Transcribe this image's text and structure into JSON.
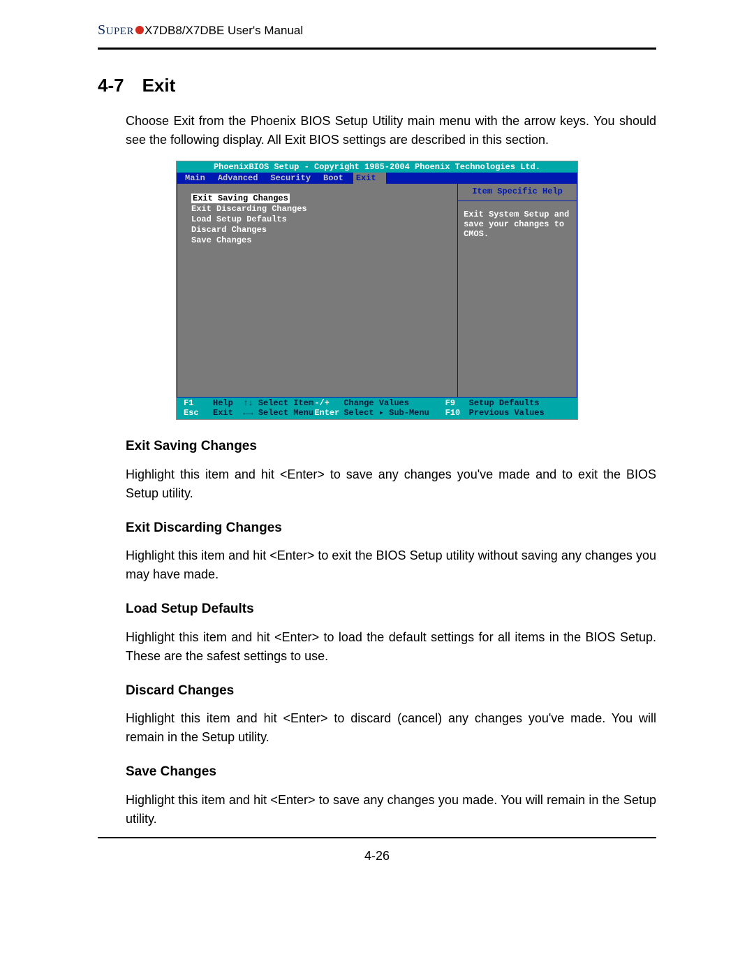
{
  "header": {
    "brand_caps_big": "S",
    "brand_caps_rest": "UPER",
    "model_suffix": "X7DB8/X7DBE User's Manual"
  },
  "section": {
    "number": "4-7",
    "title": "Exit",
    "intro": "Choose Exit from the Phoenix BIOS Setup Utility main menu with the arrow keys. You should see the following display.  All Exit BIOS settings are described in this section."
  },
  "bios": {
    "title": "PhoenixBIOS Setup - Copyright 1985-2004 Phoenix Technologies Ltd.",
    "tabs": [
      "Main",
      "Advanced",
      "Security",
      "Boot",
      "Exit"
    ],
    "active_tab": "Exit",
    "options": [
      "Exit Saving Changes",
      "Exit Discarding Changes",
      "Load Setup Defaults",
      "Discard Changes",
      "Save Changes"
    ],
    "highlighted_option_index": 0,
    "help_header": "Item Specific Help",
    "help_body": "Exit System Setup and save your changes to CMOS.",
    "footer": {
      "k1": "F1",
      "d1": "Help",
      "k2": "↑↓",
      "d2": "Select Item",
      "k3": "-/+",
      "d3": "Change Values",
      "k4": "F9",
      "d4": "Setup Defaults",
      "k5": "Esc",
      "d5": "Exit",
      "k6": "←→",
      "d6": "Select Menu",
      "k7": "Enter",
      "d7": "Select ▸ Sub-Menu",
      "k8": "F10",
      "d8": "Previous Values"
    }
  },
  "items": [
    {
      "title": "Exit Saving Changes",
      "body": "Highlight this item and hit <Enter> to save any changes you've made and to exit the BIOS Setup utility."
    },
    {
      "title": "Exit Discarding Changes",
      "body": "Highlight this item and hit <Enter> to exit the BIOS Setup utility without saving any changes you may have made."
    },
    {
      "title": "Load Setup Defaults",
      "body": "Highlight this item and hit <Enter> to load the default settings for all items in the BIOS Setup.  These are the safest settings to use."
    },
    {
      "title": "Discard Changes",
      "body": "Highlight this item and hit <Enter> to discard (cancel) any changes you've  made. You will remain in the Setup utility."
    },
    {
      "title": "Save Changes",
      "body": "Highlight this item and hit <Enter> to save any changes you made.  You will remain in the Setup utility."
    }
  ],
  "page_number": "4-26"
}
